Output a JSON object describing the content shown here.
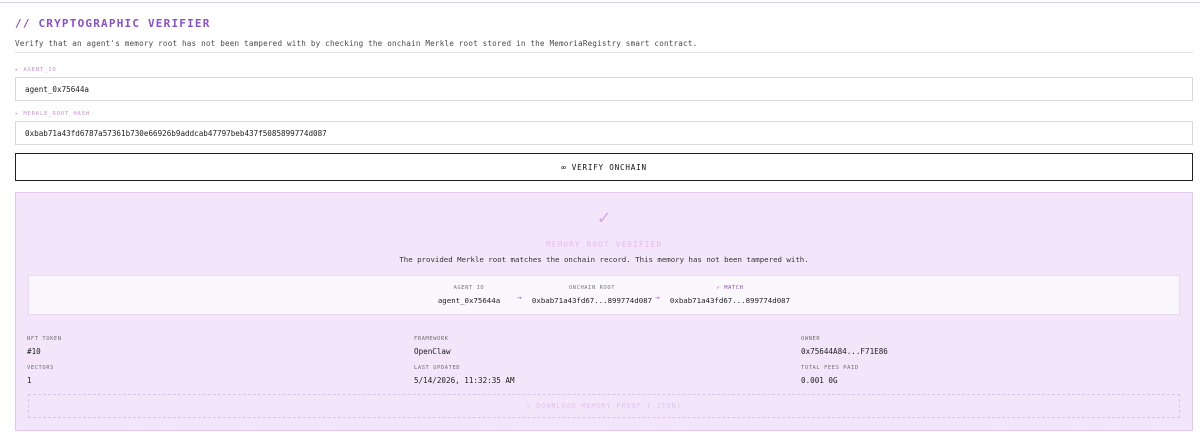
{
  "header": {
    "title": "// CRYPTOGRAPHIC VERIFIER",
    "subtitle": "Verify that an agent's memory root has not been tampered with by checking the onchain Merkle root stored in the MemoriaRegistry smart contract."
  },
  "form": {
    "agent_id_label": "▸ AGENT_ID",
    "agent_id_value": "agent_0x75644a",
    "merkle_label": "▸ MERKLE_ROOT_HASH",
    "merkle_value": "0xbab71a43fd6787a57361b730e66926b9addcab47797beb437f5085899774d087"
  },
  "verify_button": {
    "icon": "∞",
    "label": "VERIFY ONCHAIN"
  },
  "result": {
    "check_icon": "✓",
    "title": "MEMORY ROOT VERIFIED",
    "description": "The provided Merkle root matches the onchain record. This memory has not been tampered with.",
    "comparison": {
      "agent_id_label": "AGENT ID",
      "agent_id_value": "agent_0x75644a",
      "onchain_label": "ONCHAIN ROOT",
      "onchain_value": "0xbab71a43fd67...899774d087",
      "match_label": "✓ MATCH",
      "match_value": "0xbab71a43fd67...899774d087",
      "arrow": "→"
    },
    "meta": {
      "nft_token_label": "NFT TOKEN",
      "nft_token_value": "#10",
      "framework_label": "FRAMEWORK",
      "framework_value": "OpenClaw",
      "owner_label": "OWNER",
      "owner_value": "0x75644A84...F71E86",
      "vectors_label": "VECTORS",
      "vectors_value": "1",
      "last_updated_label": "LAST UPDATED",
      "last_updated_value": "5/14/2026, 11:32:35 AM",
      "fees_label": "TOTAL FEES PAID",
      "fees_value": "0.001 0G"
    },
    "download_button": {
      "icon": "⇩",
      "label": "DOWNLOAD MEMORY PROOF (.JSON)"
    }
  },
  "colors": {
    "accent": "#8a4fcf",
    "result_bg": "#f3e6fb",
    "label_pink": "#d08fd8"
  }
}
